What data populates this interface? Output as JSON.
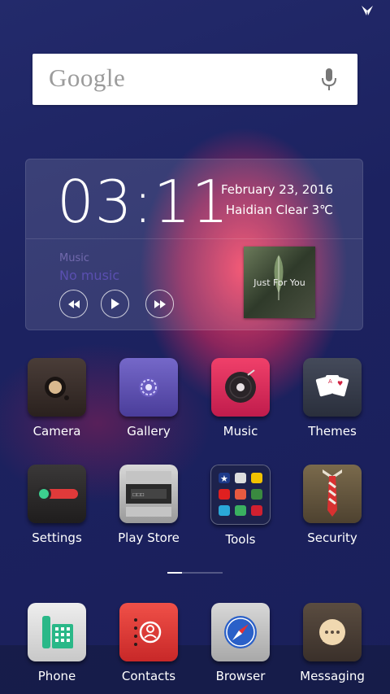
{
  "search": {
    "logo": "Google"
  },
  "widget": {
    "time": "03:11",
    "date": "February  23, 2016",
    "weather": "Haidian  Clear  3℃",
    "music_label": "Music",
    "music_title": "No music",
    "album_text": "Just For You"
  },
  "apps": [
    {
      "label": "Camera",
      "icon": "camera-icon"
    },
    {
      "label": "Gallery",
      "icon": "gallery-icon"
    },
    {
      "label": "Music",
      "icon": "music-icon"
    },
    {
      "label": "Themes",
      "icon": "themes-icon"
    },
    {
      "label": "Settings",
      "icon": "settings-icon"
    },
    {
      "label": "Play Store",
      "icon": "play-store-icon"
    },
    {
      "label": "Tools",
      "icon": "tools-folder-icon"
    },
    {
      "label": "Security",
      "icon": "security-icon"
    }
  ],
  "dock": [
    {
      "label": "Phone",
      "icon": "phone-icon"
    },
    {
      "label": "Contacts",
      "icon": "contacts-icon"
    },
    {
      "label": "Browser",
      "icon": "browser-icon"
    },
    {
      "label": "Messaging",
      "icon": "messaging-icon"
    }
  ]
}
